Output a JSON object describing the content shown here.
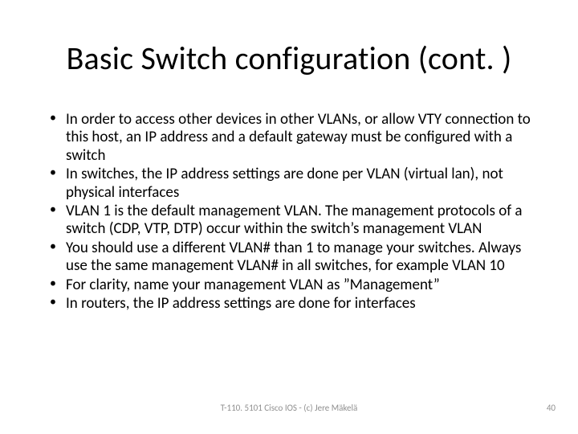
{
  "slide": {
    "title": "Basic Switch configuration (cont. )",
    "bullets": [
      "In order to access other devices in other VLANs, or allow VTY connection to this host, an IP address and a default gateway must be configured with a switch",
      "In switches, the IP address settings are done per VLAN (virtual lan), not physical interfaces",
      "VLAN 1 is the default management VLAN. The management protocols of a switch (CDP, VTP, DTP) occur within the switch’s management VLAN",
      "You should use a different VLAN# than 1 to manage your switches. Always use the same management VLAN# in all switches, for example VLAN 10",
      "For clarity, name your management VLAN as ”Management”",
      "In routers, the IP address settings are done for interfaces"
    ],
    "footer_center": "T-110. 5101 Cisco IOS - (c) Jere Mäkelä",
    "page_number": "40"
  }
}
